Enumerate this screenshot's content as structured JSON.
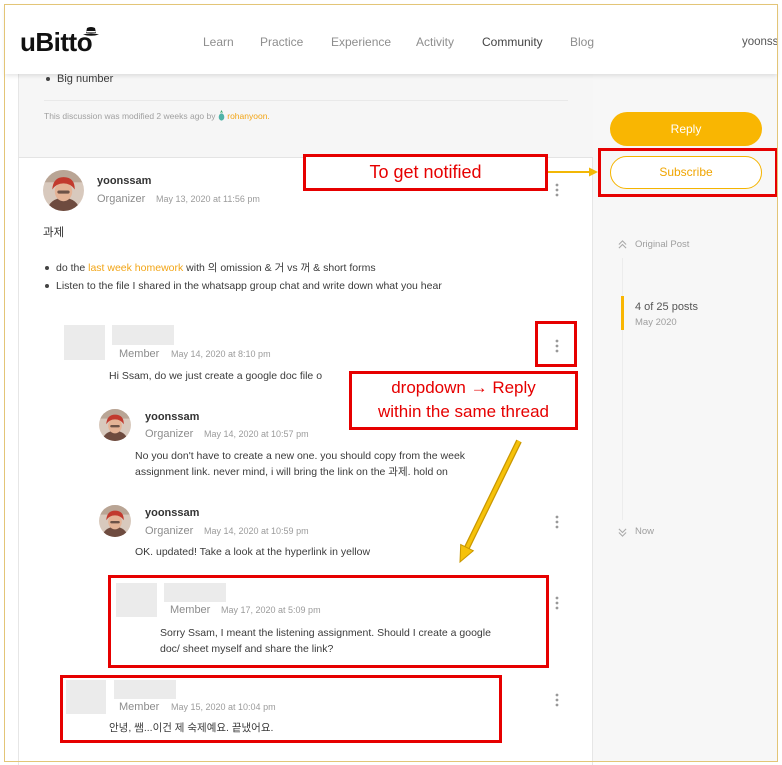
{
  "colors": {
    "accent": "#f9b602",
    "link": "#f2a516",
    "annotation_red": "#e60000",
    "annotation_arrow": "#f6c20a",
    "sidebar_bg": "#f7f7f7",
    "placeholder_gray": "#ebebeb"
  },
  "icons": {
    "logo_mark": "hat-icon",
    "post_menu": "more-vertical-icon",
    "timeline_start": "double-chevron-up-icon",
    "timeline_end": "double-chevron-down-icon",
    "editor_badge": "pineapple-icon"
  },
  "header": {
    "logo": "uBitto",
    "nav": [
      {
        "label": "Learn",
        "active": false
      },
      {
        "label": "Practice",
        "active": false
      },
      {
        "label": "Experience",
        "active": false
      },
      {
        "label": "Activity",
        "active": false
      },
      {
        "label": "Community",
        "active": true
      },
      {
        "label": "Blog",
        "active": false
      }
    ],
    "user": "yoonss"
  },
  "original_post": {
    "bullet": "Big number",
    "modified_text": "This discussion was modified 2 weeks ago by",
    "modified_by": "rohanyoon."
  },
  "posts": [
    {
      "author": "yoonssam",
      "role": "Organizer",
      "date": "May 13, 2020 at 11:56 pm",
      "title": "과제",
      "bullets": [
        {
          "before": "do the",
          "link": "last week homework",
          "after": "with 의 omission & 거 vs 꺼 & short forms"
        },
        {
          "text": "Listen to the file I shared in the whatsapp group chat and write down what you hear"
        }
      ]
    },
    {
      "role": "Member",
      "date": "May 14, 2020 at 8:10 pm",
      "lines": [
        "Hi Ssam, do we just create a google doc file o"
      ]
    },
    {
      "author": "yoonssam",
      "role": "Organizer",
      "date": "May 14, 2020 at 10:57 pm",
      "lines": [
        "No you don't have to create a new one. you should copy from the week",
        "assignment link. never mind, i will bring the link on the 과제. hold on"
      ]
    },
    {
      "author": "yoonssam",
      "role": "Organizer",
      "date": "May 14, 2020 at 10:59 pm",
      "lines": [
        "OK. updated! Take a look at the hyperlink in yellow"
      ]
    },
    {
      "role": "Member",
      "date": "May 17, 2020 at 5:09 pm",
      "lines": [
        "Sorry Ssam, I meant the listening assignment. Should I create a google",
        "doc/ sheet myself and share the link?"
      ]
    },
    {
      "role": "Member",
      "date": "May 15, 2020 at 10:04 pm",
      "lines": [
        "안녕, 쌤...이건 제 숙제예요. 끝냈어요."
      ]
    }
  ],
  "sidebar": {
    "reply_label": "Reply",
    "subscribe_label": "Subscribe",
    "timeline": {
      "start": "Original Post",
      "position": "4 of 25 posts",
      "position_date": "May 2020",
      "end": "Now"
    }
  },
  "annotations": {
    "notify_label": "To get notified",
    "dropdown_line1": "dropdown → Reply",
    "dropdown_line2": "within the same thread"
  }
}
